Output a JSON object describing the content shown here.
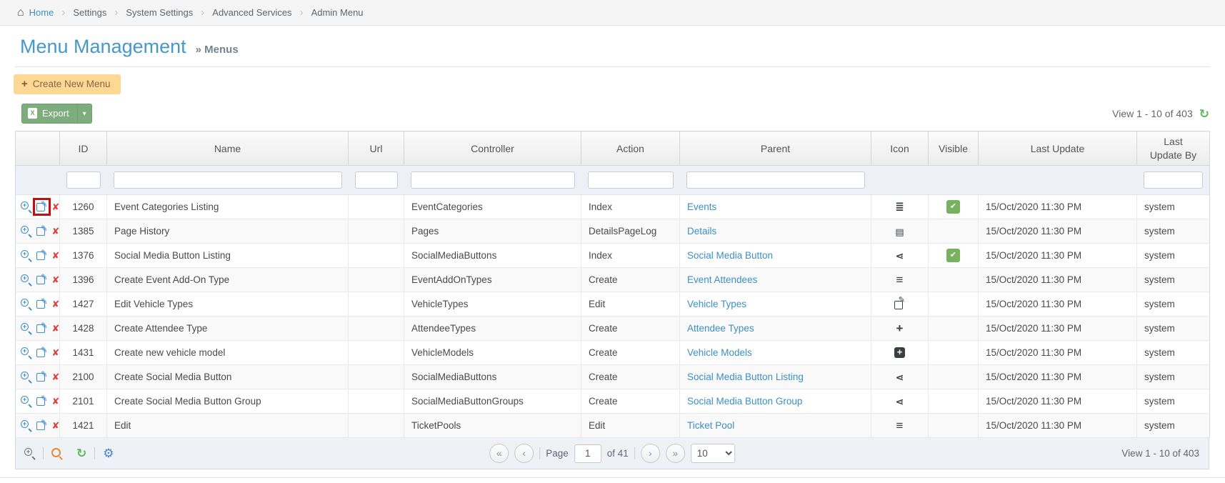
{
  "colors": {
    "link_blue": "#3d8fc6",
    "title_blue": "#4698cb",
    "success_green": "#5cb85c",
    "export_green": "#7dad7d",
    "delete_red": "#d9443c",
    "annotation_red": "#c40d0d",
    "create_btn_bg": "#fcd894",
    "create_btn_text": "#8a6540",
    "search_orange": "#ef8432",
    "gear_blue": "#4584d1"
  },
  "breadcrumb": {
    "home": "Home",
    "separator": "›",
    "items": [
      "Settings",
      "System Settings",
      "Advanced Services",
      "Admin Menu"
    ]
  },
  "page": {
    "title": "Menu Management",
    "subtitle": "» Menus"
  },
  "toolbar": {
    "create_plus": "+",
    "create_label": "Create New Menu",
    "export_icon_letter": "X",
    "export_label": "Export",
    "export_caret": "▾",
    "view_info": "View 1 - 10 of 403",
    "refresh_glyph": "↻"
  },
  "grid": {
    "columns": {
      "actions": "",
      "id": "ID",
      "name": "Name",
      "url": "Url",
      "controller": "Controller",
      "action": "Action",
      "parent": "Parent",
      "icon": "Icon",
      "visible": "Visible",
      "last_update": "Last Update",
      "last_update_by": "Last Update By"
    },
    "rows": [
      {
        "id": "1260",
        "name": "Event Categories Listing",
        "url": "",
        "controller": "EventCategories",
        "action": "Index",
        "parent": "Events",
        "icon": "list-ol-icon",
        "visible": true,
        "last_update": "15/Oct/2020 11:30 PM",
        "updated_by": "system",
        "edit_annotated": true
      },
      {
        "id": "1385",
        "name": "Page History",
        "url": "",
        "controller": "Pages",
        "action": "DetailsPageLog",
        "parent": "Details",
        "icon": "book-icon",
        "visible": false,
        "last_update": "15/Oct/2020 11:30 PM",
        "updated_by": "system",
        "edit_annotated": false
      },
      {
        "id": "1376",
        "name": "Social Media Button Listing",
        "url": "",
        "controller": "SocialMediaButtons",
        "action": "Index",
        "parent": "Social Media Button",
        "icon": "share-alt-icon",
        "visible": true,
        "last_update": "15/Oct/2020 11:30 PM",
        "updated_by": "system",
        "edit_annotated": false
      },
      {
        "id": "1396",
        "name": "Create Event Add-On Type",
        "url": "",
        "controller": "EventAddOnTypes",
        "action": "Create",
        "parent": "Event Attendees",
        "icon": "bars-icon",
        "visible": false,
        "last_update": "15/Oct/2020 11:30 PM",
        "updated_by": "system",
        "edit_annotated": false
      },
      {
        "id": "1427",
        "name": "Edit Vehicle Types",
        "url": "",
        "controller": "VehicleTypes",
        "action": "Edit",
        "parent": "Vehicle Types",
        "icon": "edit-square-icon",
        "visible": false,
        "last_update": "15/Oct/2020 11:30 PM",
        "updated_by": "system",
        "edit_annotated": false
      },
      {
        "id": "1428",
        "name": "Create Attendee Type",
        "url": "",
        "controller": "AttendeeTypes",
        "action": "Create",
        "parent": "Attendee Types",
        "icon": "plus-icon",
        "visible": false,
        "last_update": "15/Oct/2020 11:30 PM",
        "updated_by": "system",
        "edit_annotated": false
      },
      {
        "id": "1431",
        "name": "Create new vehicle model",
        "url": "",
        "controller": "VehicleModels",
        "action": "Create",
        "parent": "Vehicle Models",
        "icon": "plus-square-icon",
        "visible": false,
        "last_update": "15/Oct/2020 11:30 PM",
        "updated_by": "system",
        "edit_annotated": false
      },
      {
        "id": "2100",
        "name": "Create Social Media Button",
        "url": "",
        "controller": "SocialMediaButtons",
        "action": "Create",
        "parent": "Social Media Button Listing",
        "icon": "share-alt-icon",
        "visible": false,
        "last_update": "15/Oct/2020 11:30 PM",
        "updated_by": "system",
        "edit_annotated": false
      },
      {
        "id": "2101",
        "name": "Create Social Media Button Group",
        "url": "",
        "controller": "SocialMediaButtonGroups",
        "action": "Create",
        "parent": "Social Media Button Group",
        "icon": "share-alt-icon",
        "visible": false,
        "last_update": "15/Oct/2020 11:30 PM",
        "updated_by": "system",
        "edit_annotated": false
      },
      {
        "id": "1421",
        "name": "Edit",
        "url": "",
        "controller": "TicketPools",
        "action": "Edit",
        "parent": "Ticket Pool",
        "icon": "bars-icon",
        "visible": false,
        "last_update": "15/Oct/2020 11:30 PM",
        "updated_by": "system",
        "edit_annotated": false
      }
    ]
  },
  "pagination": {
    "first": "«",
    "prev": "‹",
    "next": "›",
    "last": "»",
    "page_label": "Page",
    "current_page": "1",
    "total_label": "of 41",
    "page_size": "10",
    "view_info": "View 1 - 10 of 403"
  }
}
